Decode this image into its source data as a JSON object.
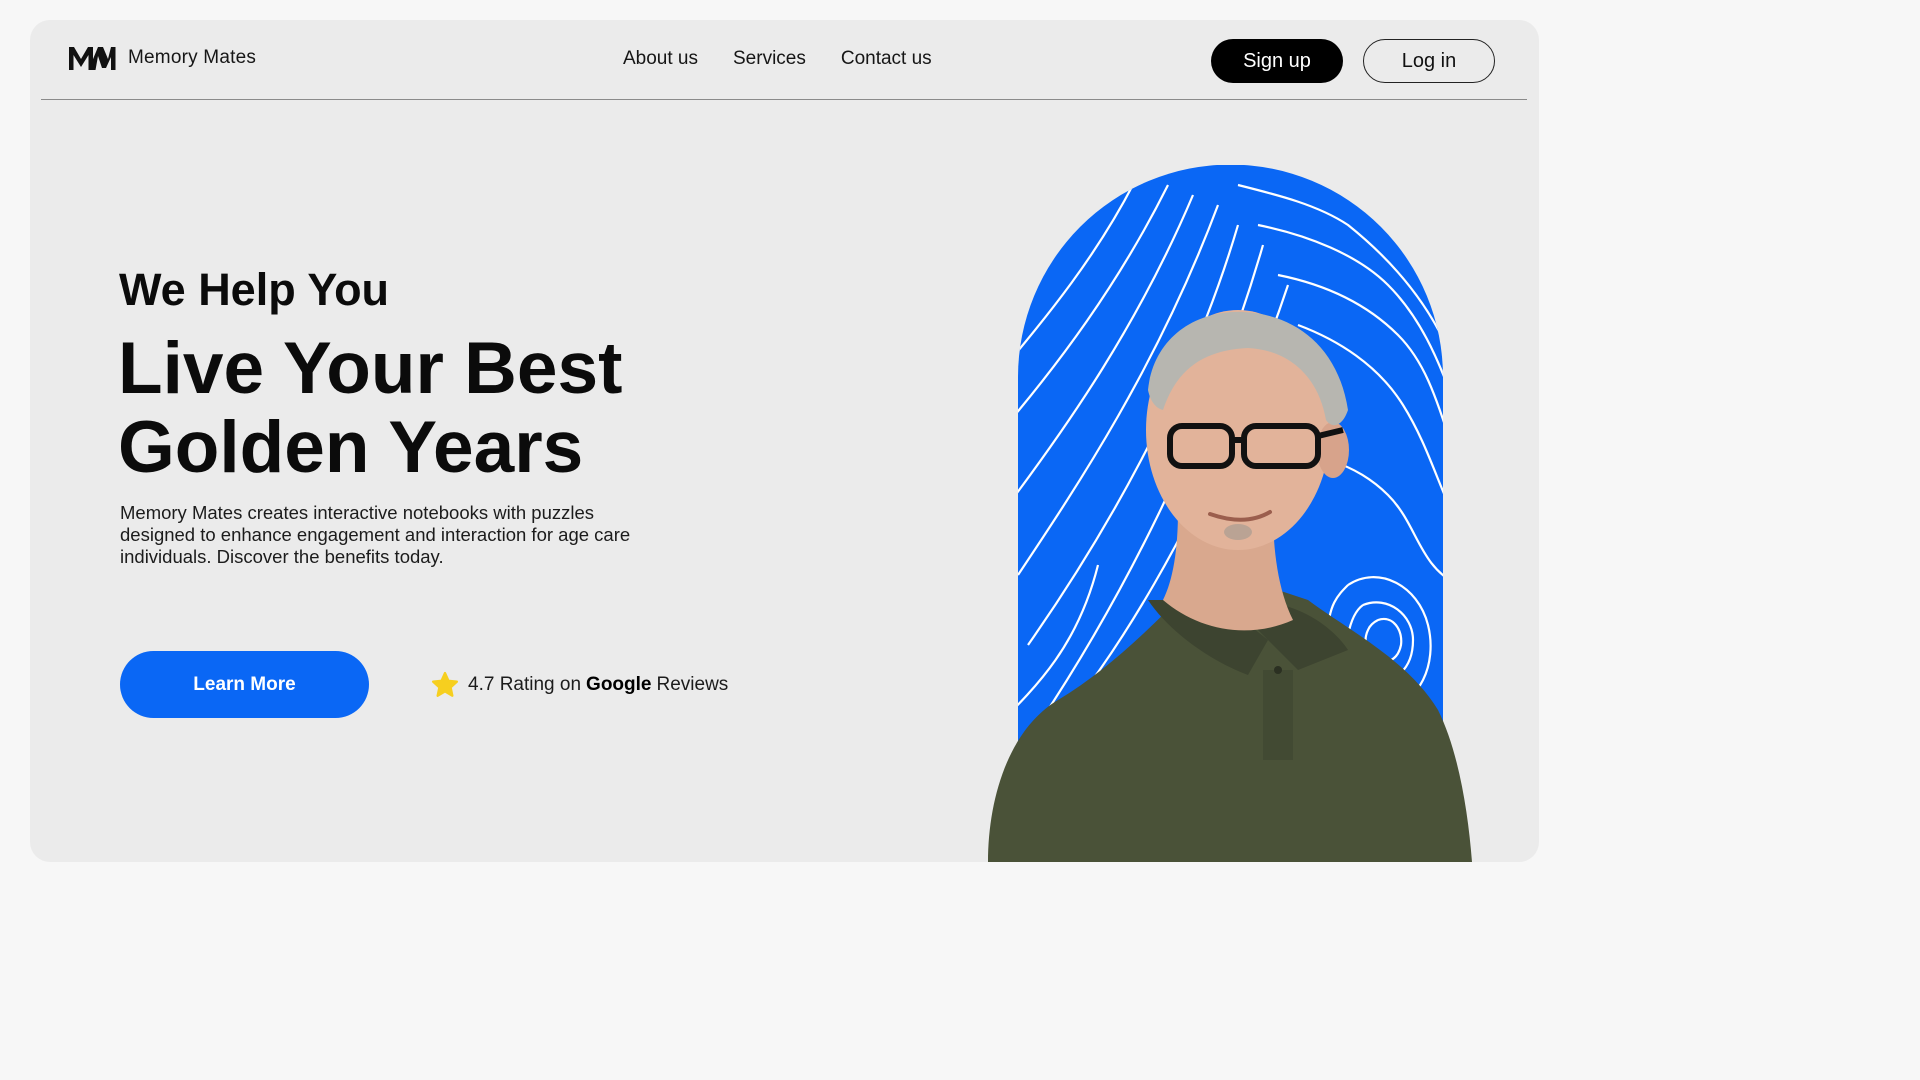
{
  "brand": {
    "logo_text": "MM",
    "name": "Memory Mates"
  },
  "nav": {
    "items": [
      "About us",
      "Services",
      "Contact us"
    ]
  },
  "auth": {
    "signup_label": "Sign up",
    "login_label": "Log in"
  },
  "hero": {
    "eyebrow": "We Help You",
    "headline": "Live Your Best Golden Years",
    "description": "Memory Mates creates interactive notebooks with puzzles designed to enhance engagement and interaction for age care individuals. Discover the benefits today.",
    "cta_label": "Learn More"
  },
  "rating": {
    "score": "4.7",
    "text_mid": "Rating on",
    "source": "Google",
    "text_end": "Reviews",
    "icon": "star-icon"
  },
  "colors": {
    "accent": "#0a67f5",
    "star": "#f6cf1f",
    "background": "#ebebeb",
    "shirt": "#4a5238"
  }
}
